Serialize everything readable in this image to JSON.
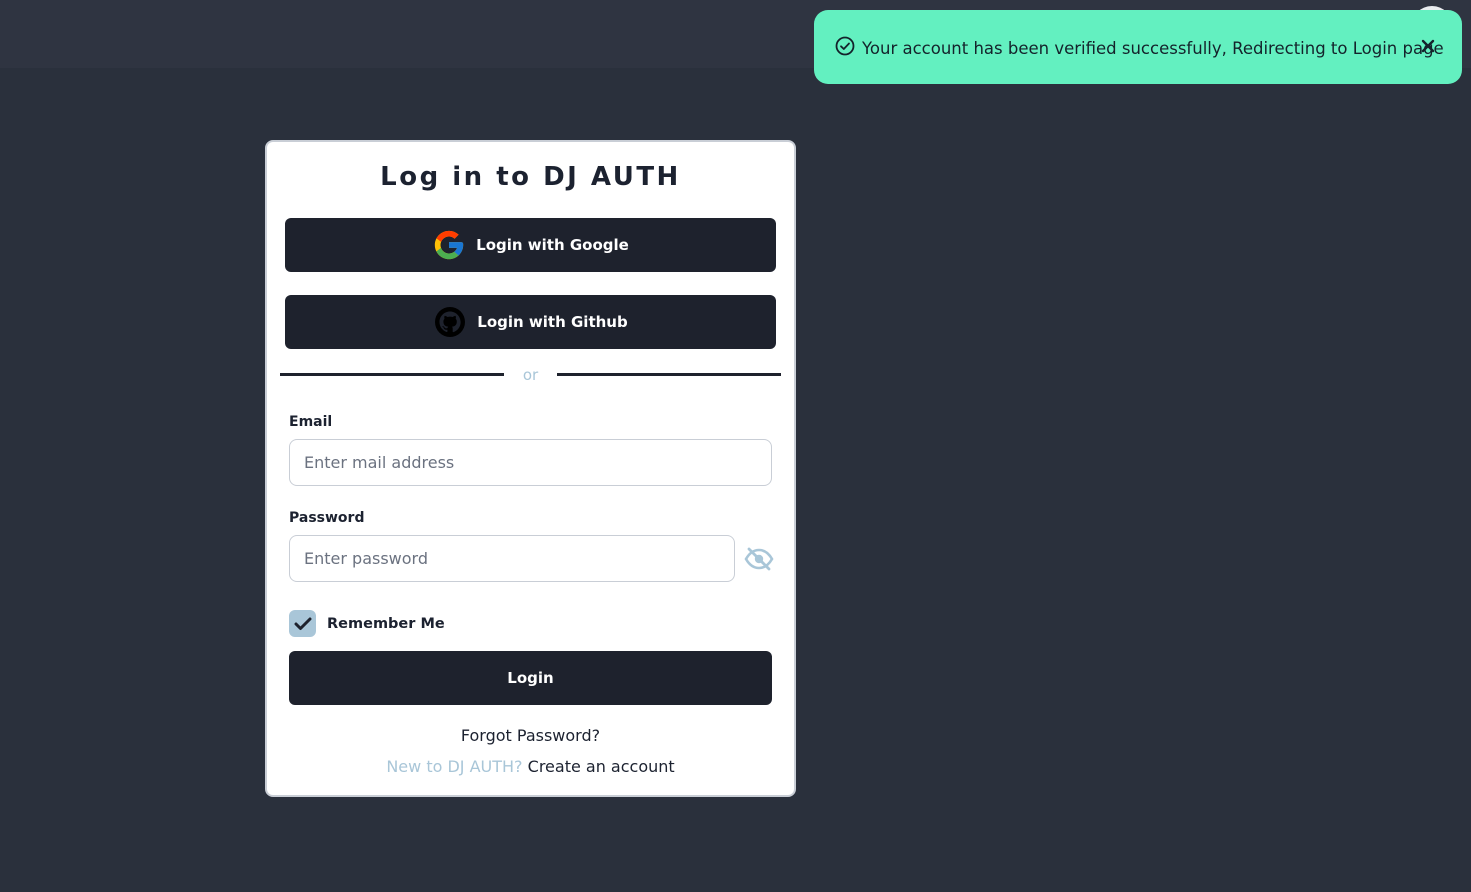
{
  "toast": {
    "message": "Your account has been verified successfully, Redirecting to Login page",
    "color": "#63f0c0"
  },
  "login": {
    "title": "Log in to DJ AUTH",
    "google_label": "Login with Google",
    "github_label": "Login with Github",
    "divider_text": "or",
    "email_label": "Email",
    "email_placeholder": "Enter mail address",
    "password_label": "Password",
    "password_placeholder": "Enter password",
    "remember_label": "Remember Me",
    "remember_checked": true,
    "login_label": "Login",
    "forgot_label": "Forgot Password?",
    "signup_prompt": "New to DJ AUTH?",
    "signup_link": "Create an account"
  },
  "colors": {
    "background": "#2a303c",
    "button": "#1e222d",
    "accent_muted": "#a9c6d8"
  },
  "icons": [
    "check-circle-icon",
    "close-icon",
    "google-icon",
    "github-icon",
    "eye-slash-icon",
    "checkmark-icon"
  ]
}
